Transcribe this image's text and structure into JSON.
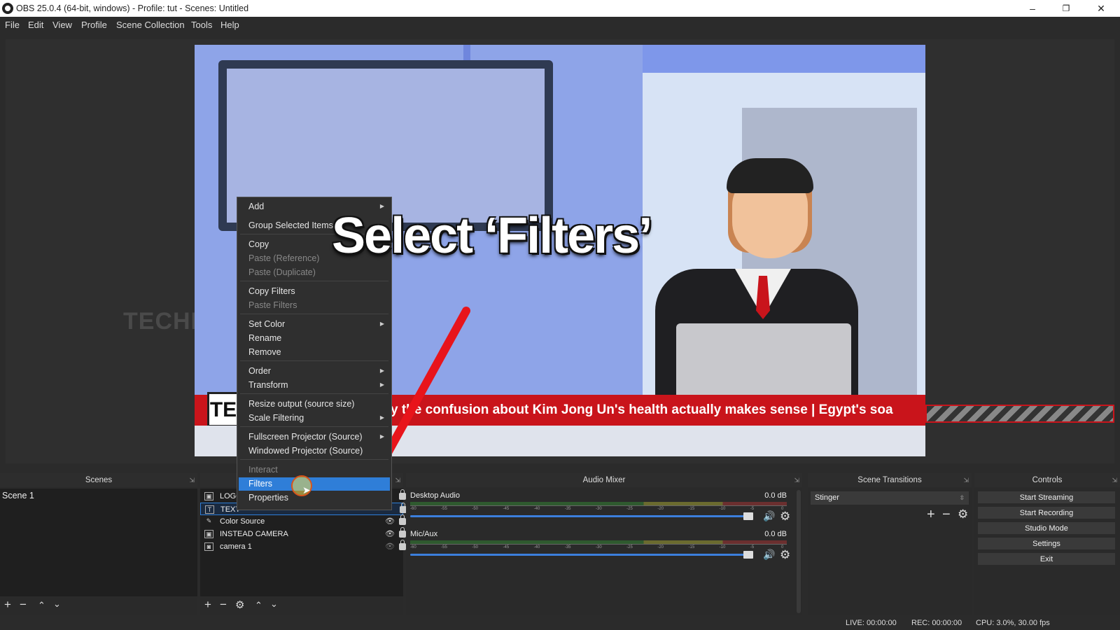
{
  "window": {
    "title": "OBS 25.0.4 (64-bit, windows) - Profile: tut - Scenes: Untitled",
    "minimize": "–",
    "restore": "❐",
    "close": "✕"
  },
  "menu": [
    "File",
    "Edit",
    "View",
    "Profile",
    "Scene Collection",
    "Tools",
    "Help"
  ],
  "preview": {
    "ticker_text": "y the confusion about Kim Jong Un's health actually makes sense | Egypt's soa",
    "watermark": "TECHNOW",
    "ticker_logo": "TE"
  },
  "overlay_caption": "Select ‘Filters’",
  "context_menu": {
    "items": [
      {
        "label": "Add",
        "submenu": true,
        "disabled": false
      },
      {
        "label": "Group Selected Items",
        "submenu": false,
        "disabled": false
      },
      {
        "label": "Copy",
        "submenu": false,
        "disabled": false
      },
      {
        "label": "Paste (Reference)",
        "submenu": false,
        "disabled": true
      },
      {
        "label": "Paste (Duplicate)",
        "submenu": false,
        "disabled": true
      },
      {
        "label": "Copy Filters",
        "submenu": false,
        "disabled": false
      },
      {
        "label": "Paste Filters",
        "submenu": false,
        "disabled": true
      },
      {
        "label": "Set Color",
        "submenu": true,
        "disabled": false
      },
      {
        "label": "Rename",
        "submenu": false,
        "disabled": false
      },
      {
        "label": "Remove",
        "submenu": false,
        "disabled": false
      },
      {
        "label": "Order",
        "submenu": true,
        "disabled": false
      },
      {
        "label": "Transform",
        "submenu": true,
        "disabled": false
      },
      {
        "label": "Resize output (source size)",
        "submenu": false,
        "disabled": false
      },
      {
        "label": "Scale Filtering",
        "submenu": true,
        "disabled": false
      },
      {
        "label": "Fullscreen Projector (Source)",
        "submenu": true,
        "disabled": false
      },
      {
        "label": "Windowed Projector (Source)",
        "submenu": false,
        "disabled": false
      },
      {
        "label": "Interact",
        "submenu": false,
        "disabled": true
      },
      {
        "label": "Filters",
        "submenu": false,
        "disabled": false,
        "highlighted": true
      },
      {
        "label": "Properties",
        "submenu": false,
        "disabled": false
      }
    ]
  },
  "docks": {
    "scenes": {
      "title": "Scenes",
      "items": [
        "Scene 1"
      ]
    },
    "sources": {
      "items": [
        {
          "name": "LOGO",
          "icon": "image-icon"
        },
        {
          "name": "TEXT",
          "icon": "text-icon"
        },
        {
          "name": "Color Source",
          "icon": "brush-icon"
        },
        {
          "name": "INSTEAD CAMERA",
          "icon": "image-icon"
        },
        {
          "name": "camera 1",
          "icon": "camera-icon"
        }
      ]
    },
    "audio_mixer": {
      "title": "Audio Mixer",
      "tracks": [
        {
          "name": "Desktop Audio",
          "db": "0.0 dB"
        },
        {
          "name": "Mic/Aux",
          "db": "0.0 dB"
        }
      ]
    },
    "scene_transitions": {
      "title": "Scene Transitions",
      "selected": "Stinger"
    },
    "controls": {
      "title": "Controls",
      "buttons": [
        "Start Streaming",
        "Start Recording",
        "Studio Mode",
        "Settings",
        "Exit"
      ]
    }
  },
  "status": {
    "live": "LIVE: 00:00:00",
    "rec": "REC: 00:00:00",
    "cpu": "CPU: 3.0%, 30.00 fps"
  },
  "colors": {
    "accent": "#2f7ed8",
    "ticker": "#c9141b",
    "annotation_arrow": "#e8141b"
  }
}
